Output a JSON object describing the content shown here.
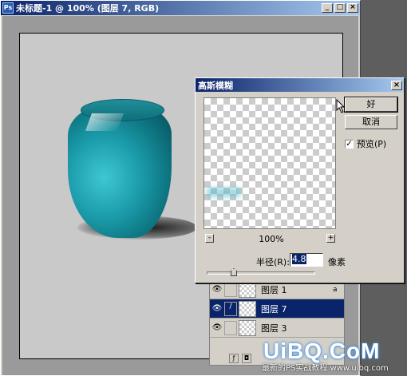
{
  "document": {
    "title": "未标题-1 @ 100% (图层 7, RGB)",
    "min_label": "_",
    "max_label": "□",
    "close_label": "×"
  },
  "layers": [
    {
      "name": "图层 1",
      "selected": false,
      "link": "",
      "lock": "a"
    },
    {
      "name": "图层 7",
      "selected": true,
      "link": "/",
      "lock": ""
    },
    {
      "name": "图层 3",
      "selected": false,
      "link": "",
      "lock": ""
    }
  ],
  "dialog": {
    "title": "高斯模糊",
    "close_label": "×",
    "ok_label": "好",
    "cancel_label": "取消",
    "preview_label": "预览(P)",
    "preview_checked": "✓",
    "zoom_minus": "-",
    "zoom_plus": "+",
    "zoom_value": "100%",
    "radius_label": "半径(R):",
    "radius_value": "4.8",
    "unit_label": "像素"
  },
  "watermark": {
    "logo": "UiBQ.CoM",
    "sub": "最新的PS实战教程 www.uibq.com"
  }
}
